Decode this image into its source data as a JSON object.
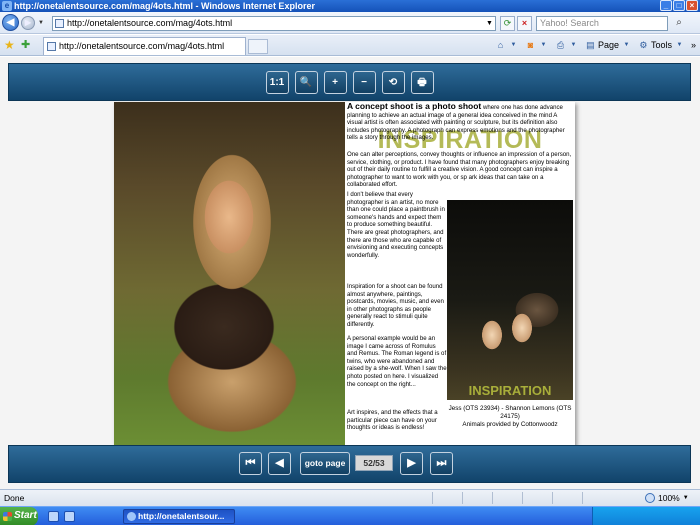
{
  "window": {
    "title": "http://onetalentsource.com/mag/4ots.html - Windows Internet Explorer",
    "minimize": "_",
    "maximize": "□",
    "close": "×"
  },
  "address": {
    "url": "http://onetalentsource.com/mag/4ots.html",
    "search_placeholder": "Yahoo! Search"
  },
  "tab": {
    "title": "http://onetalentsource.com/mag/4ots.html"
  },
  "commands": {
    "page": "Page",
    "tools": "Tools",
    "overflow": "»"
  },
  "viewer_toolbar": {
    "actual_size": "1:1",
    "zoom": "🔍",
    "zoom_in": "+",
    "zoom_out": "−",
    "flip": "⟲",
    "print": "🖶"
  },
  "article": {
    "headline": "INSPIRATION",
    "lead": "A concept shoot is a photo shoot",
    "p1_rest": " where one has done advance planning to achieve an actual image of a general idea conceived in the mind A visual artist is often associated with painting or sculpture, but its definition also includes photography. A photograph can express emotions and the photographer tells a story through the images.",
    "p2": "One can alter perceptions, convey thoughts or influence an impression of a person, service, clothing, or product.  I have found that many photographers enjoy breaking out of their daily routine to fulfill a creative vision. A good concept can inspire a photographer to want to work with you, or sp ark ideas that can take on a collaborated effort.",
    "p3": "I don't believe that every photographer is an artist, no more than one could place a paintbrush in someone's hands and expect them to produce something beautiful. There are great photographers, and there are those who are capable of envisioning and executing concepts wonderfully.",
    "p4": "Inspiration for a shoot can be found almost anywhere, paintings, postcards, movies, music, and even in other photographs as people generally react to stimuli quite differently.",
    "p5": "A personal example would be an image I came across of Romulus and Remus. The Roman legend is of twins, who were abandoned and raised by a she-wolf. When I saw the photo posted on here.  I visualized the concept on the right...",
    "p6": "Art inspires, and the effects that a particular piece can have on your thoughts or ideas is endless!",
    "painting_title": "INSPIRATION",
    "caption_line1": "Jess (OTS 23934) - Shannon Lemons (OTS 24175)",
    "caption_line2": "Animals provided by Cottonwoodz"
  },
  "viewer_nav": {
    "first": "⏮",
    "prev": "◀",
    "goto": "goto page",
    "page": "52/53",
    "next": "▶",
    "last": "⏭"
  },
  "status": {
    "text": "Done",
    "zoom": "100%"
  },
  "taskbar": {
    "start": "Start",
    "task": "http://onetalentsour..."
  }
}
